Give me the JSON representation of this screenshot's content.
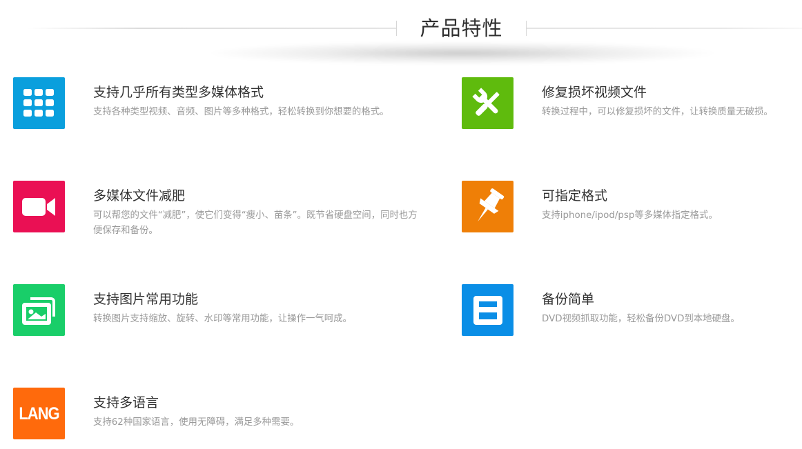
{
  "section": {
    "title": "产品特性"
  },
  "colors": {
    "grid_icon": "#0a9fdd",
    "repair_icon": "#5fbb0d",
    "video_icon": "#ea1054",
    "pin_icon": "#ef7f07",
    "image_icon": "#19ce69",
    "save_icon": "#0a8ee6",
    "lang_icon": "#ff6a0c"
  },
  "features": [
    {
      "icon": "grid-icon",
      "title": "支持几乎所有类型多媒体格式",
      "desc": "支持各种类型视频、音频、图片等多种格式，轻松转换到你想要的格式。"
    },
    {
      "icon": "tools-icon",
      "title": "修复损坏视频文件",
      "desc": "转换过程中，可以修复损坏的文件，让转换质量无破损。"
    },
    {
      "icon": "video-camera-icon",
      "title": "多媒体文件减肥",
      "desc": "可以帮您的文件“减肥”，使它们变得“瘦小、苗条”。既节省硬盘空间，同时也方便保存和备份。"
    },
    {
      "icon": "pushpin-icon",
      "title": "可指定格式",
      "desc": "支持iphone/ipod/psp等多媒体指定格式。"
    },
    {
      "icon": "image-gallery-icon",
      "title": "支持图片常用功能",
      "desc": "转换图片支持缩放、旋转、水印等常用功能，让操作一气呵成。"
    },
    {
      "icon": "floppy-save-icon",
      "title": "备份简单",
      "desc": "DVD视频抓取功能，轻松备份DVD到本地硬盘。"
    },
    {
      "icon": "lang-icon",
      "icon_text": "LANG",
      "title": "支持多语言",
      "desc": "支持62种国家语言，使用无障碍，满足多种需要。"
    }
  ]
}
